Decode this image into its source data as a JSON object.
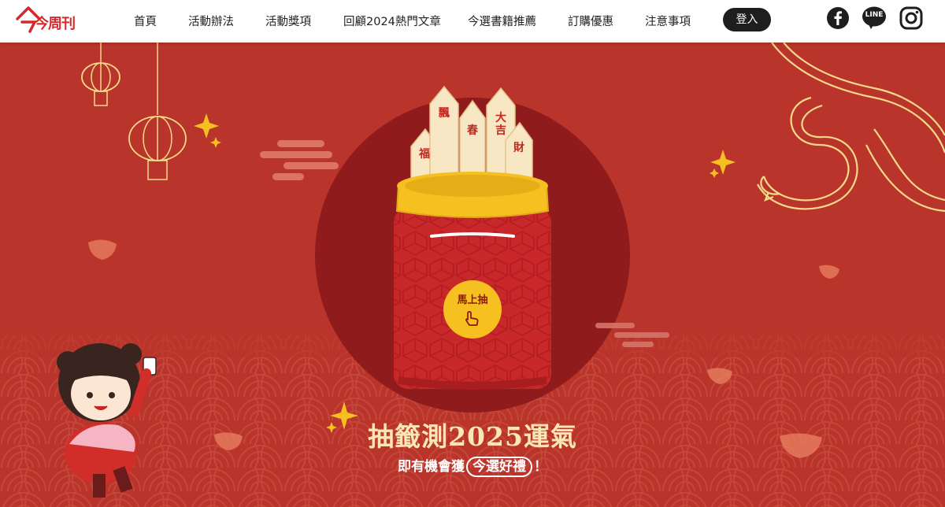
{
  "header": {
    "logo_text": "今周刊",
    "nav": [
      {
        "label": "首頁"
      },
      {
        "label": "活動辦法"
      },
      {
        "label": "活動獎項"
      },
      {
        "label": "回顧2024熱門文章"
      },
      {
        "label": "今選書籍推薦"
      },
      {
        "label": "訂購優惠"
      },
      {
        "label": "注意事項"
      }
    ],
    "login_label": "登入",
    "social": {
      "facebook": "facebook-icon",
      "line": "line-icon",
      "line_text": "LINE",
      "instagram": "instagram-icon"
    }
  },
  "hero": {
    "sticks": [
      "福",
      "飄",
      "春",
      "大吉",
      "財"
    ],
    "draw_button_label": "馬上抽",
    "title": "抽籤測2025運氣",
    "subtitle_before": "即有機會獲",
    "subtitle_highlight": "今選好禮",
    "subtitle_after": "！"
  },
  "colors": {
    "background": "#b9342a",
    "circle": "#8f1b1c",
    "jar": "#c9282a",
    "jar_rim": "#f6c020",
    "title": "#fbe7b4",
    "accent": "#f6c020"
  }
}
